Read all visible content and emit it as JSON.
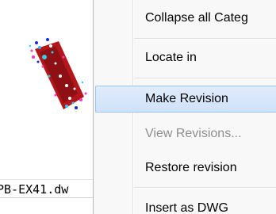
{
  "left_panel": {
    "filename": "PB-EX41.dw"
  },
  "menu": {
    "items": [
      {
        "label": "Collapse all Categ",
        "state": "normal"
      },
      {
        "label": "Locate in",
        "state": "normal"
      },
      {
        "label": "Make Revision",
        "state": "highlighted"
      },
      {
        "label": "View Revisions...",
        "state": "disabled"
      },
      {
        "label": "Restore revision",
        "state": "normal"
      },
      {
        "label": "Insert as DWG",
        "state": "normal"
      }
    ],
    "highlight_color": "#cfe2f9",
    "disabled_color": "#8d8d8d"
  }
}
